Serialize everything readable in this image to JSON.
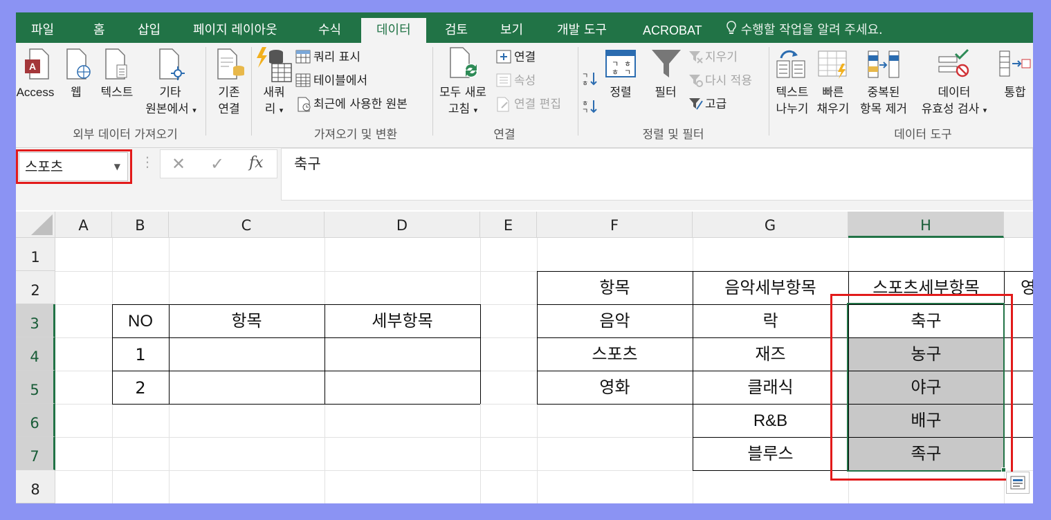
{
  "tabs": [
    "파일",
    "홈",
    "삽입",
    "페이지 레이아웃",
    "수식",
    "데이터",
    "검토",
    "보기",
    "개발 도구",
    "ACROBAT"
  ],
  "tell_me": "수행할 작업을 알려 주세요.",
  "ribbon": {
    "external": {
      "access": "Access",
      "web": "웹",
      "text": "텍스트",
      "other_line1": "기타",
      "other_line2": "원본에서",
      "existing_line1": "기존",
      "existing_line2": "연결",
      "group": "외부 데이터 가져오기"
    },
    "transform": {
      "newquery_line1": "새쿼",
      "newquery_line2": "리",
      "show_queries": "쿼리 표시",
      "from_table": "테이블에서",
      "recent_sources": "최근에 사용한 원본",
      "group": "가져오기 및 변환"
    },
    "connections": {
      "refresh_line1": "모두 새로",
      "refresh_line2": "고침",
      "connections": "연결",
      "properties": "속성",
      "edit_links": "연결 편집",
      "group": "연결"
    },
    "sortfilter": {
      "sort": "정렬",
      "filter": "필터",
      "clear": "지우기",
      "reapply": "다시 적용",
      "advanced": "고급",
      "group": "정렬 및 필터"
    },
    "datatools": {
      "text_to_col_line1": "텍스트",
      "text_to_col_line2": "나누기",
      "flash_line1": "빠른",
      "flash_line2": "채우기",
      "dup_line1": "중복된",
      "dup_line2": "항목 제거",
      "valid_line1": "데이터",
      "valid_line2": "유효성 검사",
      "consolidate": "통합",
      "group": "데이터 도구"
    }
  },
  "formula_bar": {
    "name_box": "스포츠",
    "cancel": "✕",
    "enter": "✓",
    "fx": "fx",
    "content": "축구"
  },
  "columns": [
    "A",
    "B",
    "C",
    "D",
    "E",
    "F",
    "G",
    "H"
  ],
  "selected_column": "H",
  "rows": [
    "1",
    "2",
    "3",
    "4",
    "5",
    "6",
    "7",
    "8"
  ],
  "table1": {
    "headers": [
      "NO",
      "항목",
      "세부항목"
    ],
    "row_numbers": [
      "1",
      "2"
    ]
  },
  "table2": {
    "headers": [
      "항목",
      "음악세부항목",
      "스포츠세부항목"
    ],
    "header_partial": "영",
    "items": [
      "음악",
      "스포츠",
      "영화"
    ],
    "music": [
      "락",
      "재즈",
      "클래식",
      "R&B",
      "블루스"
    ],
    "sports": [
      "축구",
      "농구",
      "야구",
      "배구",
      "족구"
    ]
  },
  "colors": {
    "excel_green": "#217346",
    "highlight_red": "#e21a1a",
    "background": "#8b93f3",
    "selected_fill": "#c8c8c8"
  }
}
